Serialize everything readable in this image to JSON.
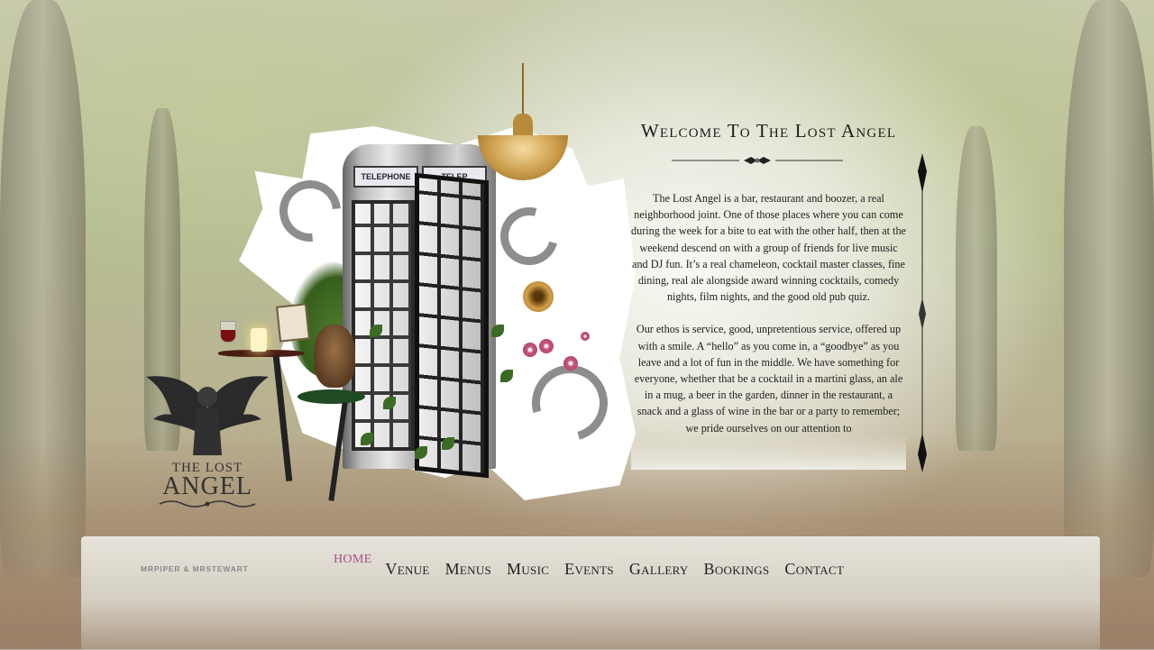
{
  "site": {
    "logo_line1": "THE LOST",
    "logo_line2": "ANGEL"
  },
  "collage": {
    "phone_sign": "TELEPHONE",
    "phone_sign_partial": "TELEP"
  },
  "content": {
    "heading": "Welcome To The Lost Angel",
    "paragraph1": "The Lost Angel is a bar, restaurant and boozer, a real neighborhood joint. One of those places where you can come during the week for a bite to eat with the other half, then at the weekend descend on with a group of friends for live music and DJ fun. It’s a real chameleon, cocktail master classes, fine dining, real ale alongside award winning cocktails, comedy nights, film nights, and the good old pub quiz.",
    "paragraph2": "Our ethos is service, good, unpretentious service, offered up with a smile. A “hello” as you come in, a “goodbye” as you leave and a lot of fun in the middle. We have something for everyone, whether that be a cocktail in a martini glass, an ale in a mug, a beer in the garden, dinner in the restaurant, a snack and a glass of wine in the bar or a party to remember; we pride ourselves on our attention to"
  },
  "footer": {
    "credit": "MRPIPER & MRSTEWART"
  },
  "nav": {
    "items": [
      {
        "label": "HOME",
        "active": true
      },
      {
        "label": "Venue"
      },
      {
        "label": "Menus"
      },
      {
        "label": "Music"
      },
      {
        "label": "Events"
      },
      {
        "label": "Gallery"
      },
      {
        "label": "Bookings"
      },
      {
        "label": "Contact"
      }
    ]
  },
  "colors": {
    "active_nav": "#a5508a",
    "text": "#1f1f1f",
    "background": "#b9b79e"
  }
}
